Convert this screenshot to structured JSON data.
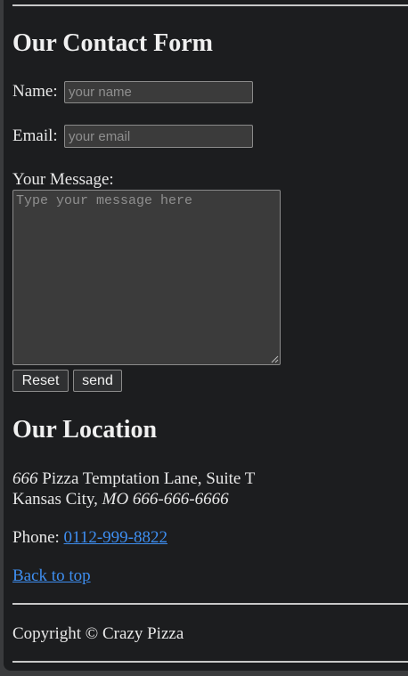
{
  "contact": {
    "heading": "Our Contact Form",
    "name_label": "Name:",
    "name_placeholder": "your name",
    "email_label": "Email:",
    "email_placeholder": "your email",
    "message_label": "Your Message:",
    "message_placeholder": "Type your message here",
    "reset_label": "Reset",
    "send_label": "send"
  },
  "location": {
    "heading": "Our Location",
    "street_number": "666",
    "street_rest": " Pizza Temptation Lane, Suite T",
    "city": "Kansas City, ",
    "state_zip": "MO 666-666-6666",
    "phone_label": "Phone: ",
    "phone_number": "0112-999-8822",
    "back_to_top": "Back to top"
  },
  "footer": {
    "copyright": "Copyright © Crazy Pizza"
  },
  "colors": {
    "background": "#1c1d1f",
    "link": "#3e8ef0",
    "text": "#e8e8e8"
  }
}
